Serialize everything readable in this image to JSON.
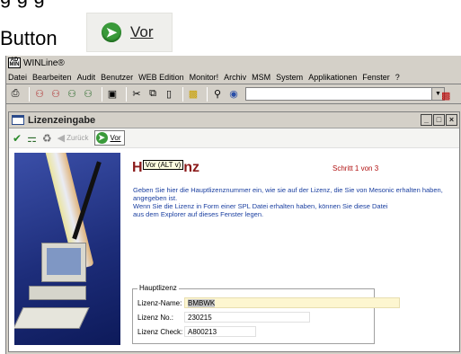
{
  "caption": {
    "cut_text": "g                                    g                     g",
    "word": "Button",
    "button_label": "Vor"
  },
  "app": {
    "title": "WINLine®",
    "logo_text": "AD MIN",
    "menu": [
      "Datei",
      "Bearbeiten",
      "Audit",
      "Benutzer",
      "WEB Edition",
      "Monitor!",
      "Archiv",
      "MSM",
      "System",
      "Applikationen",
      "Fenster",
      "?"
    ],
    "combo_value": ""
  },
  "child": {
    "title": "Lizenzeingabe",
    "toolbar": {
      "back_label": "Zurück",
      "next_label": "Vor"
    }
  },
  "wizard": {
    "title_start": "H",
    "tooltip": "Vor (ALT v)",
    "title_end": "nz",
    "step": "Schritt  1  von 3",
    "text_line1": "Geben Sie hier die Hauptlizenznummer ein, wie sie auf der Lizenz, die Sie von Mesonic erhalten haben,",
    "text_line2": "angegeben ist.",
    "text_line3": "Wenn Sie die Lizenz in Form einer SPL Datei erhalten haben, können Sie diese Datei",
    "text_line4": "aus dem Explorer auf dieses Fenster legen."
  },
  "license": {
    "group_label": "Hauptlizenz",
    "name_label": "Lizenz-Name:",
    "name_value": "BMBWK",
    "number_label": "Lizenz No.:",
    "number_value": "230215",
    "check_label": "Lizenz Check:",
    "check_value": "A800213"
  }
}
